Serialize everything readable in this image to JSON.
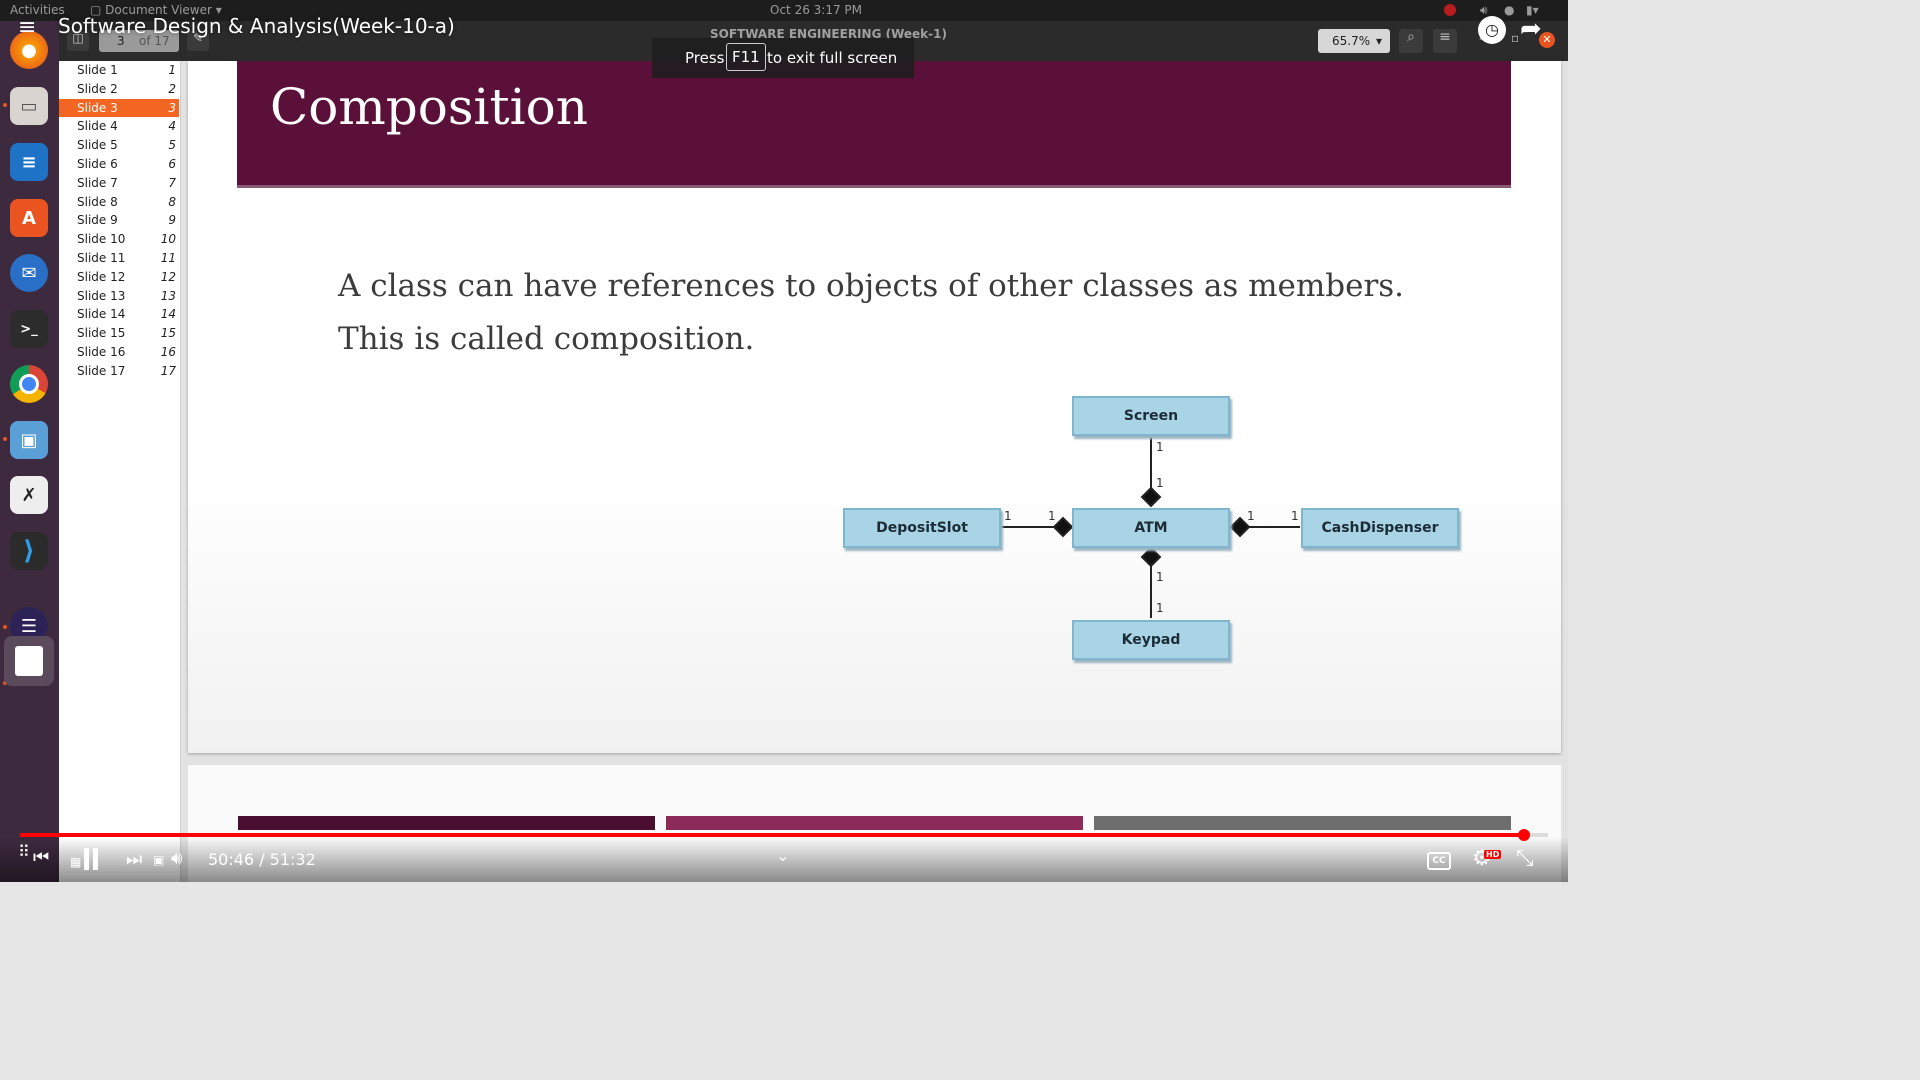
{
  "system_bar": {
    "activities": "Activities",
    "app_name": "Document Viewer",
    "clock": "Oct 26   3:17 PM"
  },
  "video": {
    "title": "Software Design & Analysis(Week-10-a)",
    "fullscreen_hint": {
      "press": "Press",
      "key": "F11",
      "rest": "to exit full screen"
    },
    "time": "50:46 / 51:32",
    "progress": 0.984,
    "hd_badge": "HD"
  },
  "viewer": {
    "window_title": "SOFTWARE ENGINEERING (Week-1)",
    "page_current": "3",
    "page_total": "of 17",
    "zoom": "65.7%"
  },
  "sidebar": {
    "items": [
      {
        "label": "Slide 1",
        "num": "1"
      },
      {
        "label": "Slide 2",
        "num": "2"
      },
      {
        "label": "Slide 3",
        "num": "3",
        "active": true
      },
      {
        "label": "Slide 4",
        "num": "4"
      },
      {
        "label": "Slide 5",
        "num": "5"
      },
      {
        "label": "Slide 6",
        "num": "6"
      },
      {
        "label": "Slide 7",
        "num": "7"
      },
      {
        "label": "Slide 8",
        "num": "8"
      },
      {
        "label": "Slide 9",
        "num": "9"
      },
      {
        "label": "Slide 10",
        "num": "10"
      },
      {
        "label": "Slide 11",
        "num": "11"
      },
      {
        "label": "Slide 12",
        "num": "12"
      },
      {
        "label": "Slide 13",
        "num": "13"
      },
      {
        "label": "Slide 14",
        "num": "14"
      },
      {
        "label": "Slide 15",
        "num": "15"
      },
      {
        "label": "Slide 16",
        "num": "16"
      },
      {
        "label": "Slide 17",
        "num": "17"
      }
    ]
  },
  "slide": {
    "title": "Composition",
    "line1": "A class can have references to objects of other classes as members.",
    "line2": "This is called composition.",
    "diagram": {
      "screen": "Screen",
      "atm": "ATM",
      "deposit": "DepositSlot",
      "cash": "CashDispenser",
      "keypad": "Keypad",
      "multiplicity": "1"
    }
  },
  "colors": {
    "title_band": "#5a1038",
    "accent": "#f26522",
    "uml_box": "#a9d4e6",
    "progress": "#ff0000"
  }
}
